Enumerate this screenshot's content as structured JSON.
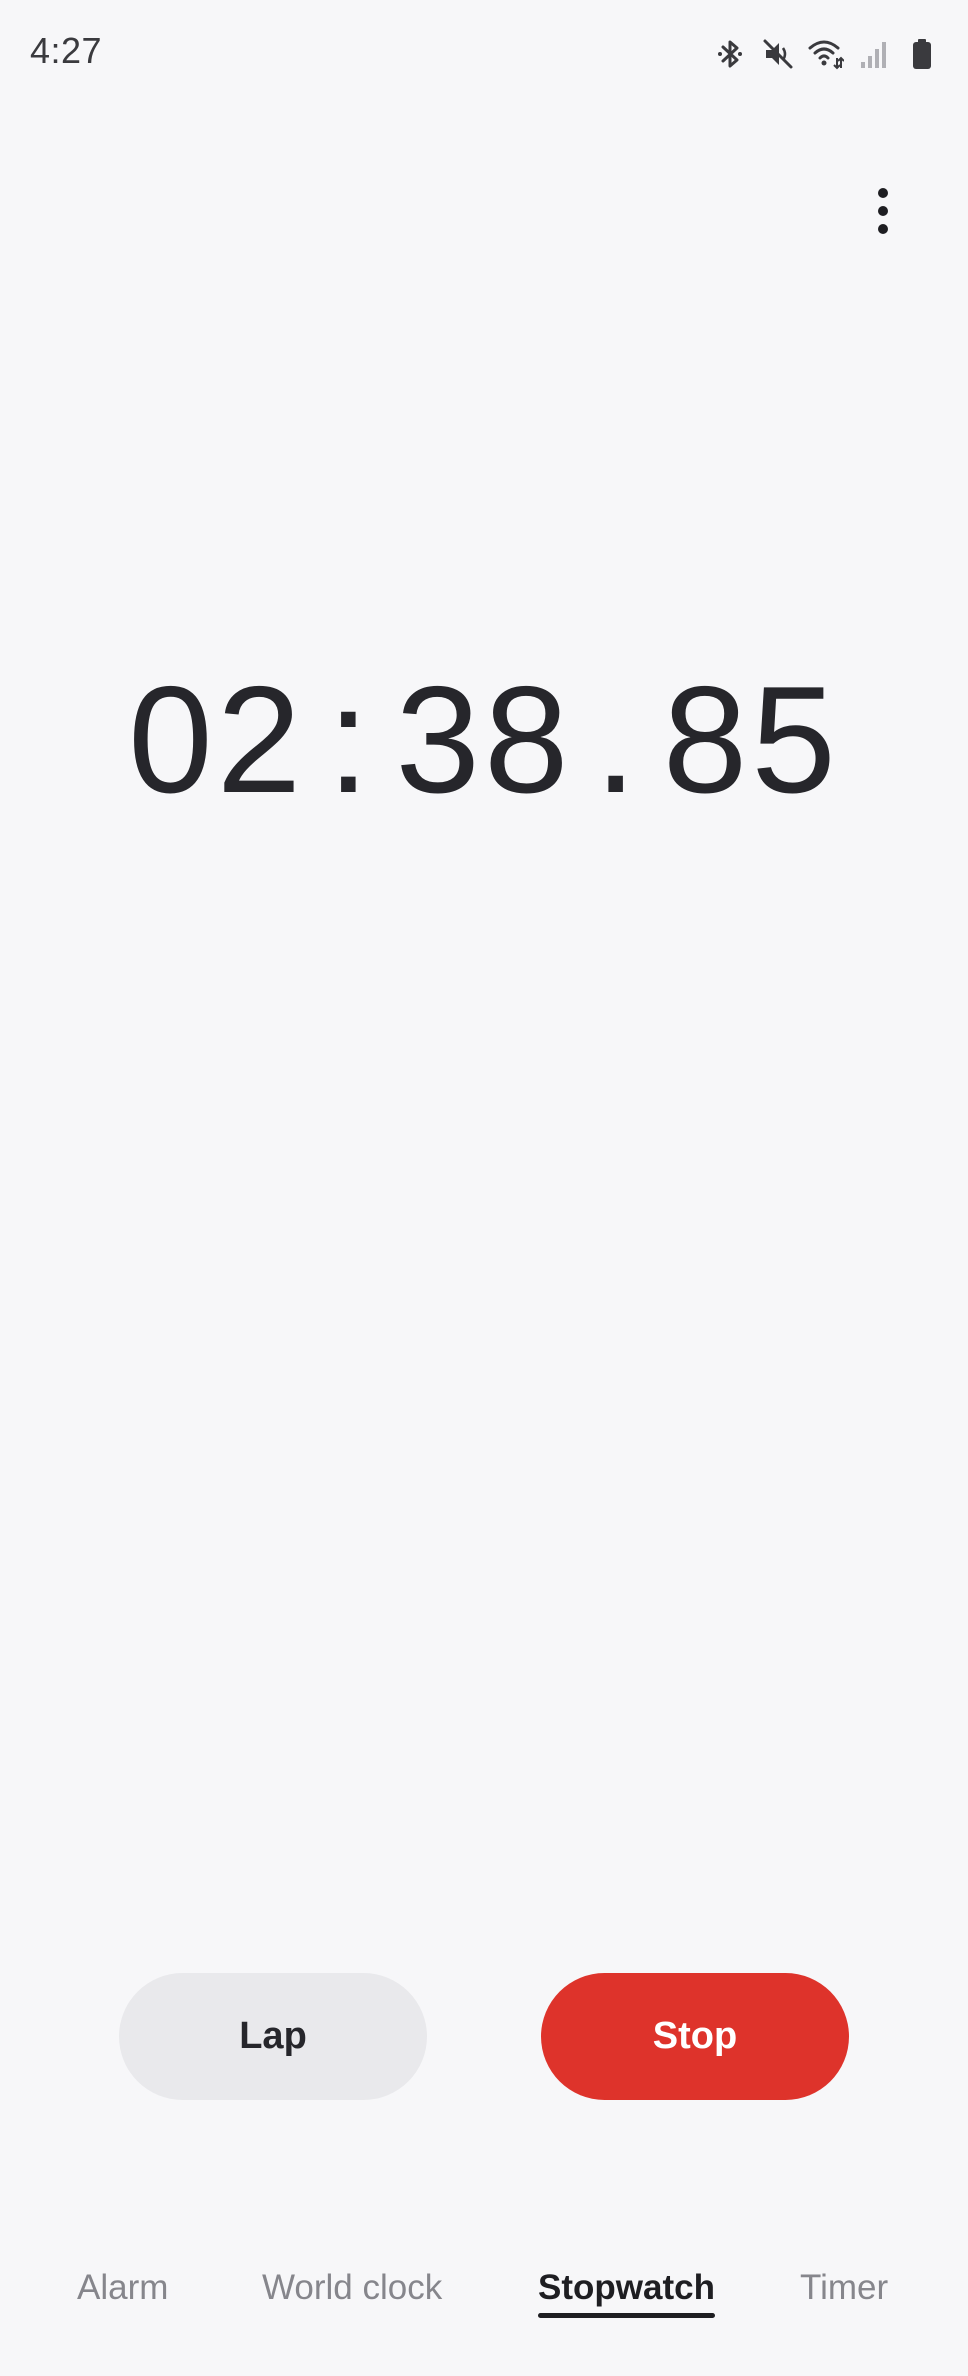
{
  "status_bar": {
    "time": "4:27",
    "icons": [
      "bluetooth-icon",
      "mute-icon",
      "wifi-icon",
      "signal-icon",
      "battery-icon"
    ]
  },
  "toolbar": {
    "more_icon": "more-vert-icon"
  },
  "stopwatch": {
    "minutes": "02",
    "separator_1": ":",
    "seconds": "38",
    "separator_2": ".",
    "hundredths": "85"
  },
  "buttons": {
    "lap_label": "Lap",
    "stop_label": "Stop"
  },
  "tabs": [
    {
      "label": "Alarm",
      "active": false
    },
    {
      "label": "World clock",
      "active": false
    },
    {
      "label": "Stopwatch",
      "active": true
    },
    {
      "label": "Timer",
      "active": false
    }
  ],
  "colors": {
    "background": "#f7f7f9",
    "stop_button": "#de332b",
    "lap_button": "#e9e9ec",
    "text_primary": "#26262b",
    "tab_inactive": "#86868c"
  }
}
